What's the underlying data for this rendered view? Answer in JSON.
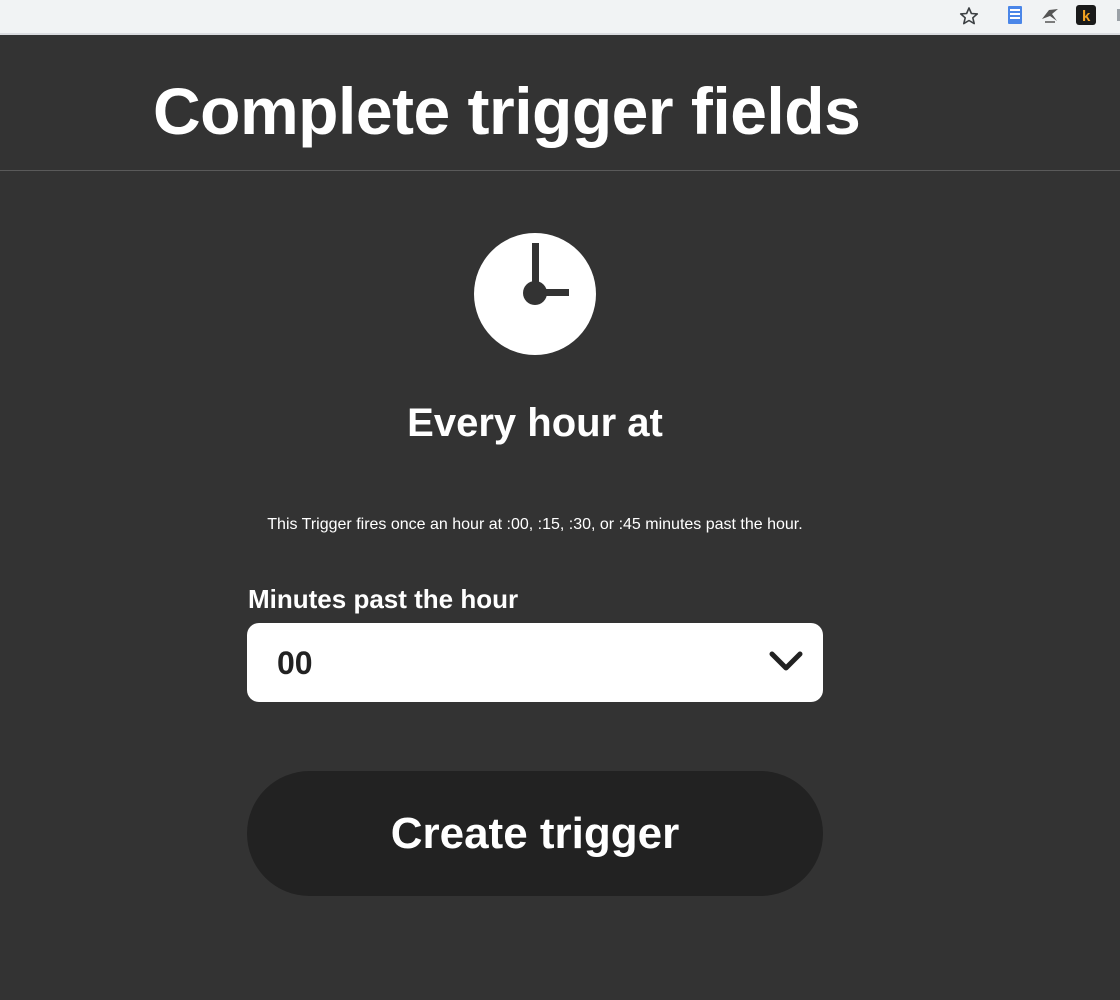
{
  "browser": {
    "icons": [
      "star-icon",
      "doc-extension-icon",
      "bird-extension-icon",
      "k-extension-icon"
    ],
    "k_extension_letter": "k"
  },
  "page": {
    "title": "Complete trigger fields"
  },
  "trigger": {
    "icon": "clock-icon",
    "name": "Every hour at",
    "description": "This Trigger fires once an hour at :00, :15, :30, or :45 minutes past the hour."
  },
  "field": {
    "label": "Minutes past the hour",
    "selected_value": "00",
    "icon": "chevron-down-icon"
  },
  "actions": {
    "create_label": "Create trigger"
  },
  "colors": {
    "background": "#333333",
    "button": "#222222",
    "text": "#ffffff"
  }
}
